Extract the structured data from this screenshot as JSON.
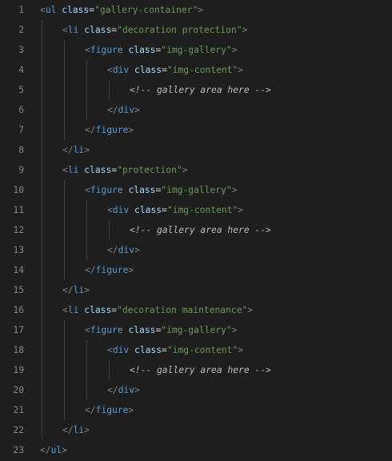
{
  "lines": [
    {
      "n": "1",
      "indent": 0,
      "kind": "open",
      "tag": "ul",
      "attr": "class",
      "value": "\"gallery-container\""
    },
    {
      "n": "2",
      "indent": 1,
      "kind": "open",
      "tag": "li",
      "attr": "class",
      "value": "\"decoration protection\""
    },
    {
      "n": "3",
      "indent": 2,
      "kind": "open",
      "tag": "figure",
      "attr": "class",
      "value": "\"img-gallery\""
    },
    {
      "n": "4",
      "indent": 3,
      "kind": "open",
      "tag": "div",
      "attr": "class",
      "value": "\"img-content\""
    },
    {
      "n": "5",
      "indent": 4,
      "kind": "comment",
      "text": "<!-- gallery area here -->"
    },
    {
      "n": "6",
      "indent": 3,
      "kind": "close",
      "tag": "div"
    },
    {
      "n": "7",
      "indent": 2,
      "kind": "close",
      "tag": "figure"
    },
    {
      "n": "8",
      "indent": 1,
      "kind": "close",
      "tag": "li"
    },
    {
      "n": "9",
      "indent": 1,
      "kind": "open",
      "tag": "li",
      "attr": "class",
      "value": "\"protection\""
    },
    {
      "n": "10",
      "indent": 2,
      "kind": "open",
      "tag": "figure",
      "attr": "class",
      "value": "\"img-gallery\""
    },
    {
      "n": "11",
      "indent": 3,
      "kind": "open",
      "tag": "div",
      "attr": "class",
      "value": "\"img-content\""
    },
    {
      "n": "12",
      "indent": 4,
      "kind": "comment",
      "text": "<!-- gallery area here -->"
    },
    {
      "n": "13",
      "indent": 3,
      "kind": "close",
      "tag": "div"
    },
    {
      "n": "14",
      "indent": 2,
      "kind": "close",
      "tag": "figure"
    },
    {
      "n": "15",
      "indent": 1,
      "kind": "close",
      "tag": "li"
    },
    {
      "n": "16",
      "indent": 1,
      "kind": "open",
      "tag": "li",
      "attr": "class",
      "value": "\"decoration maintenance\""
    },
    {
      "n": "17",
      "indent": 2,
      "kind": "open",
      "tag": "figure",
      "attr": "class",
      "value": "\"img-gallery\""
    },
    {
      "n": "18",
      "indent": 3,
      "kind": "open",
      "tag": "div",
      "attr": "class",
      "value": "\"img-content\""
    },
    {
      "n": "19",
      "indent": 4,
      "kind": "comment",
      "text": "<!-- gallery area here -->"
    },
    {
      "n": "20",
      "indent": 3,
      "kind": "close",
      "tag": "div"
    },
    {
      "n": "21",
      "indent": 2,
      "kind": "close",
      "tag": "figure"
    },
    {
      "n": "22",
      "indent": 1,
      "kind": "close",
      "tag": "li"
    },
    {
      "n": "23",
      "indent": 0,
      "kind": "close",
      "tag": "ul"
    }
  ],
  "colors": {
    "background": "#1e1e1e",
    "line_number": "#858585",
    "bracket": "#808080",
    "tag_name": "#569cd6",
    "attribute": "#9cdcfe",
    "string": "#6a9955",
    "comment": "#d4d4d4",
    "indent_guide": "#404040"
  }
}
